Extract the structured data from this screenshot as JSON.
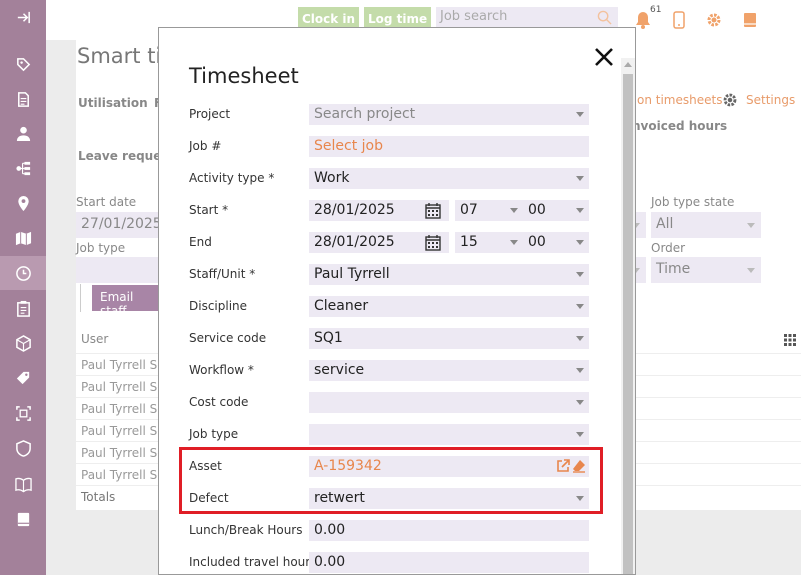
{
  "topbar": {
    "clock_in": "Clock in",
    "log_time": "Log time",
    "job_search_placeholder": "Job search",
    "notification_count": "61"
  },
  "background": {
    "page_title": "Smart tim",
    "tabs": [
      "Utilisation",
      "F"
    ],
    "leave_requests": "Leave reques",
    "open_timesheets": "on timesheets",
    "settings": "Settings",
    "invoiced_hours": "nvoiced hours",
    "start_date_label": "Start date",
    "start_date_value": "27/01/2025",
    "job_type_label": "Job type",
    "job_type_state_label": "Job type state",
    "job_type_state_value": "All",
    "order_label": "Order",
    "order_value": "Time",
    "email_staff": "Email staff",
    "user_header": "User",
    "rows": [
      "Paul Tyrrell Sc",
      "Paul Tyrrell Sc",
      "Paul Tyrrell Sc",
      "Paul Tyrrell Sc",
      "Paul Tyrrell Sc",
      "Paul Tyrrell Sc"
    ],
    "totals": "Totals"
  },
  "modal": {
    "title": "Timesheet",
    "fields": {
      "project": {
        "label": "Project",
        "placeholder": "Search project"
      },
      "job": {
        "label": "Job #",
        "placeholder": "Select job"
      },
      "activity_type": {
        "label": "Activity type *",
        "value": "Work"
      },
      "start": {
        "label": "Start *",
        "date": "28/01/2025",
        "hour": "07",
        "minute": "00"
      },
      "end": {
        "label": "End",
        "date": "28/01/2025",
        "hour": "15",
        "minute": "00"
      },
      "staff_unit": {
        "label": "Staff/Unit *",
        "value": "Paul Tyrrell"
      },
      "discipline": {
        "label": "Discipline",
        "value": "Cleaner"
      },
      "service_code": {
        "label": "Service code",
        "value": "SQ1"
      },
      "workflow": {
        "label": "Workflow *",
        "value": "service"
      },
      "cost_code": {
        "label": "Cost code",
        "value": ""
      },
      "job_type": {
        "label": "Job type",
        "value": ""
      },
      "asset": {
        "label": "Asset",
        "value": "A-159342"
      },
      "defect": {
        "label": "Defect",
        "value": "retwert"
      },
      "lunch_break": {
        "label": "Lunch/Break Hours",
        "value": "0.00"
      },
      "travel_hours": {
        "label": "Included travel hours",
        "value": "0.00"
      }
    }
  },
  "colors": {
    "sidebar": "#a3819a",
    "accent_orange": "#e8864c",
    "field_bg": "#ede9f3",
    "highlight_red": "#e01e26",
    "green_button": "#c4dcaa"
  }
}
